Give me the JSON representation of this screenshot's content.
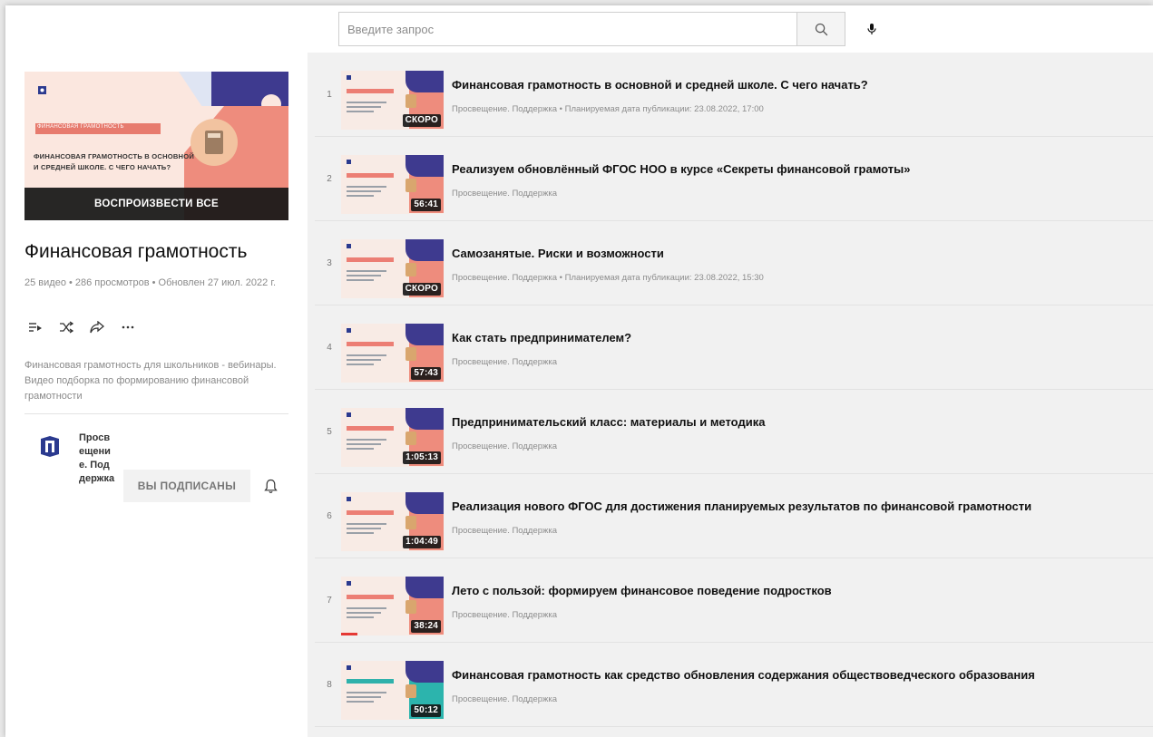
{
  "search": {
    "placeholder": "Введите запрос"
  },
  "colors": {
    "accent_pink": "#ee8c7d",
    "accent_navy": "#3e3a8f",
    "accent_teal": "#2cb4ad"
  },
  "playlist": {
    "hero_stripe": "ФИНАНСОВАЯ ГРАМОТНОСТЬ",
    "hero_text": "Финансовая грамотность в основной и средней школе. С чего начать?",
    "play_all": "ВОСПРОИЗВЕСТИ ВСЕ",
    "title": "Финансовая грамотность",
    "meta": "25 видео • 286 просмотров • Обновлен 27 июл. 2022 г.",
    "description": "Финансовая грамотность для школьников - вебинары. Видео подборка по формированию финансовой грамотности",
    "actions": [
      "save-to-queue-icon",
      "shuffle-icon",
      "share-icon",
      "more-icon"
    ]
  },
  "channel": {
    "name": "Просвещение. Поддержка",
    "subscribe_label": "ВЫ ПОДПИСАНЫ"
  },
  "videos": [
    {
      "index": "1",
      "title": "Финансовая грамотность в основной и средней школе. С чего начать?",
      "meta": "Просвещение. Поддержка • Планируемая дата публикации: 23.08.2022, 17:00",
      "badge": "СКОРО",
      "style": "pink"
    },
    {
      "index": "2",
      "title": "Реализуем обновлённый ФГОС НОО в курсе «Секреты финансовой грамоты»",
      "meta": "Просвещение. Поддержка",
      "badge": "56:41",
      "style": "pink"
    },
    {
      "index": "3",
      "title": "Самозанятые. Риски и возможности",
      "meta": "Просвещение. Поддержка • Планируемая дата публикации: 23.08.2022, 15:30",
      "badge": "СКОРО",
      "style": "pink"
    },
    {
      "index": "4",
      "title": "Как стать предпринимателем?",
      "meta": "Просвещение. Поддержка",
      "badge": "57:43",
      "style": "pink"
    },
    {
      "index": "5",
      "title": "Предпринимательский класс: материалы и методика",
      "meta": "Просвещение. Поддержка",
      "badge": "1:05:13",
      "style": "pink"
    },
    {
      "index": "6",
      "title": "Реализация нового ФГОС для достижения планируемых результатов по финансовой грамотности",
      "meta": "Просвещение. Поддержка",
      "badge": "1:04:49",
      "style": "pink"
    },
    {
      "index": "7",
      "title": "Лето с пользой: формируем финансовое поведение подростков",
      "meta": "Просвещение. Поддержка",
      "badge": "38:24",
      "style": "pink"
    },
    {
      "index": "8",
      "title": "Финансовая грамотность как средство обновления содержания обществоведческого образования",
      "meta": "Просвещение. Поддержка",
      "badge": "50:12",
      "style": "teal"
    }
  ]
}
